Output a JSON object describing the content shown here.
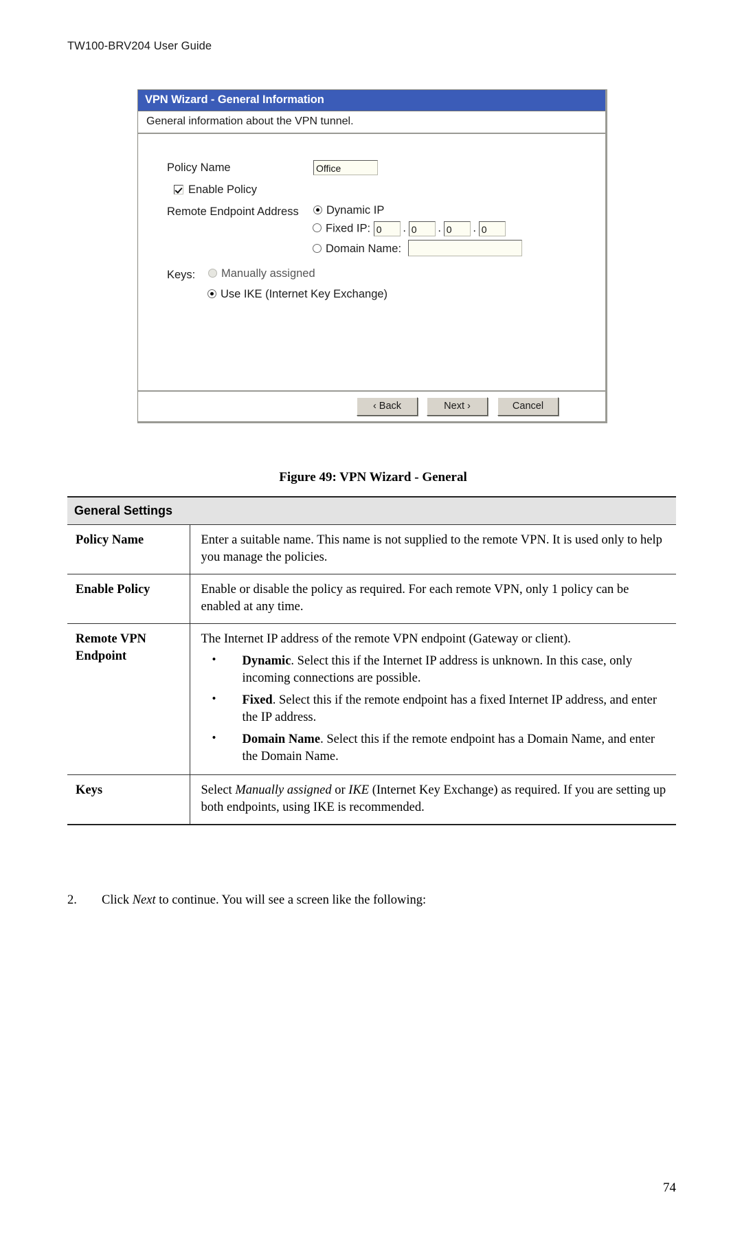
{
  "header": {
    "running_head": "TW100-BRV204 User Guide"
  },
  "dialog": {
    "title": "VPN Wizard - General Information",
    "subtitle": "General information about the VPN tunnel.",
    "fields": {
      "policy_name_label": "Policy Name",
      "policy_name_value": "Office",
      "enable_policy_label": "Enable Policy",
      "remote_endpoint_label": "Remote Endpoint Address",
      "dynamic_ip_label": "Dynamic IP",
      "fixed_ip_label": "Fixed IP:",
      "fixed_ip_octets": [
        "0",
        "0",
        "0",
        "0"
      ],
      "octet_separator": ".",
      "domain_name_label": "Domain Name:",
      "domain_name_value": "",
      "keys_label": "Keys:",
      "keys_manual_label": "Manually assigned",
      "keys_ike_label": "Use IKE (Internet Key Exchange)"
    },
    "buttons": {
      "back": "‹ Back",
      "next": "Next ›",
      "cancel": "Cancel"
    },
    "colors": {
      "titlebar": "#3b5cb8",
      "titlebar_text": "#ffffff",
      "button_face": "#d8d4cb",
      "input_background": "#fdfdf2"
    }
  },
  "caption": "Figure 49: VPN Wizard - General",
  "settings_table": {
    "section_header": "General Settings",
    "rows": [
      {
        "name": "Policy Name",
        "text": "Enter a suitable name. This name is not supplied to the remote VPN. It is used only to help you manage the policies."
      },
      {
        "name": "Enable Policy",
        "text": "Enable or disable the policy as required. For each remote VPN, only 1 policy can be enabled at any time."
      },
      {
        "name": "Remote VPN Endpoint",
        "text": "The Internet IP address of the remote VPN endpoint (Gateway or client).",
        "bullets": [
          {
            "lead": "Dynamic",
            "rest": ". Select this if the Internet IP address is unknown. In this case, only incoming connections are possible."
          },
          {
            "lead": "Fixed",
            "rest": ". Select this if the remote endpoint has a fixed Internet IP address, and enter the IP address."
          },
          {
            "lead": "Domain Name",
            "rest": ". Select this if the remote endpoint has a Domain Name, and enter the Domain Name."
          }
        ]
      },
      {
        "name": "Keys",
        "text_parts": {
          "p1": "Select ",
          "i1": "Manually assigned",
          "p2": " or ",
          "i2": "IKE",
          "p3": " (Internet Key Exchange) as required. If you are setting up both endpoints, using IKE is recommended."
        }
      }
    ]
  },
  "step": {
    "number": "2.",
    "parts": {
      "p1": "Click ",
      "i1": "Next",
      "p2": " to continue. You will see a screen like the following:"
    }
  },
  "page_number": "74"
}
